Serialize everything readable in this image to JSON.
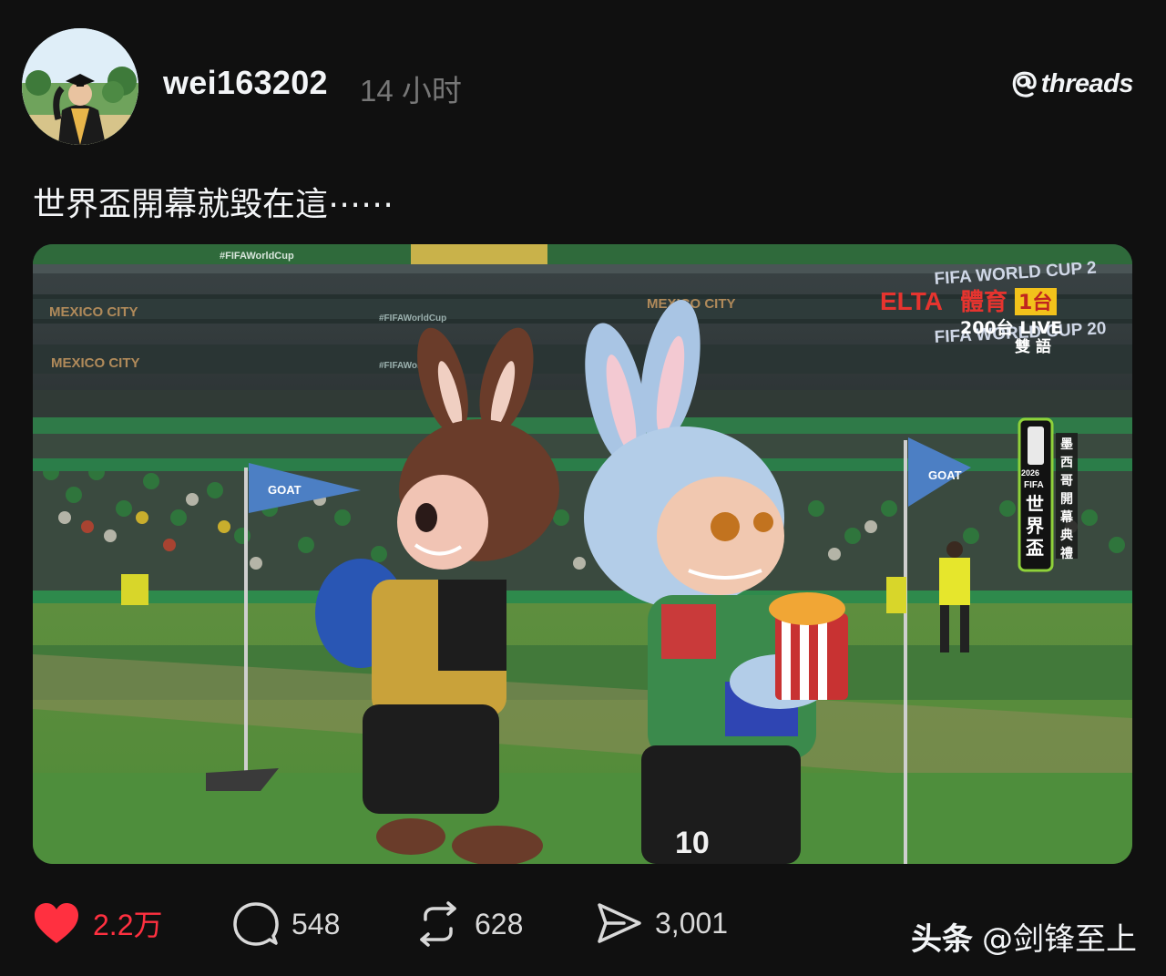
{
  "post": {
    "username": "wei163202",
    "timestamp": "14 小时",
    "caption": "世界盃開幕就毀在這⋯⋯"
  },
  "app": {
    "logo_text": "threads"
  },
  "media": {
    "image_texts": {
      "top_banner": "#FIFAWorldCup",
      "stand_sign_1": "MEXICO CITY",
      "stand_sign_2": "MEXICO CITY",
      "stand_sign_3": "#FIFAWorldCup",
      "stand_sign_4": "MEXICO CITY",
      "stand_sign_5": "#FIFAWorldCup",
      "fwc_banner": "FIFA WORLD CUP 2",
      "fwc_banner_2": "FIFA WORLD CUP 20",
      "broadcaster": "ELTA",
      "broadcaster_cn": "體育",
      "channel": "1台",
      "channel_sub": "200台 LIVE",
      "language": "雙 語",
      "wc_badge_year": "2026",
      "wc_badge_name": "FIFA",
      "wc_badge_cn": "世界盃",
      "wc_side": "墨西哥開幕典禮",
      "flag_left": "GOAT",
      "flag_right": "GOAT",
      "jersey_number": "10"
    }
  },
  "actions": {
    "likes": "2.2万",
    "replies": "548",
    "reposts": "628",
    "shares": "3,001"
  },
  "watermark": {
    "brand": "头条",
    "handle": "@剑锋至上"
  },
  "colors": {
    "background": "#101010",
    "text_primary": "#f3f5f7",
    "text_secondary": "#777777",
    "like_red": "#ff3040"
  }
}
